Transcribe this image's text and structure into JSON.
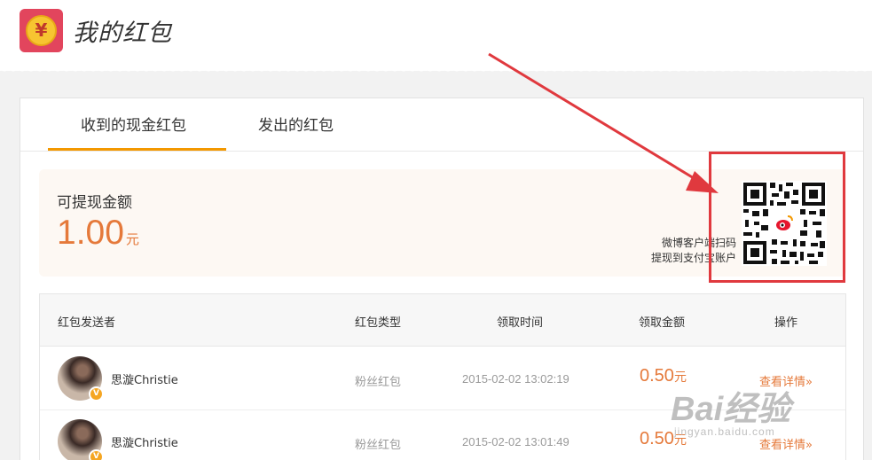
{
  "header": {
    "title": "我的红包",
    "logo_glyph": "¥"
  },
  "tabs": [
    {
      "label": "收到的现金红包",
      "active": true
    },
    {
      "label": "发出的红包",
      "active": false
    }
  ],
  "balance": {
    "label": "可提现金额",
    "amount": "1.00",
    "unit": "元",
    "qr_line1": "微博客户端扫码",
    "qr_line2": "提现到支付宝账户"
  },
  "table": {
    "columns": [
      "红包发送者",
      "红包类型",
      "领取时间",
      "领取金额",
      "操作"
    ],
    "rows": [
      {
        "sender": "思漩Christie",
        "type": "粉丝红包",
        "time": "2015-02-02 13:02:19",
        "amount": "0.50",
        "unit": "元",
        "action": "查看详情»",
        "badge": "V"
      },
      {
        "sender": "思漩Christie",
        "type": "粉丝红包",
        "time": "2015-02-02 13:01:49",
        "amount": "0.50",
        "unit": "元",
        "action": "查看详情»",
        "badge": "V"
      }
    ]
  },
  "watermark": {
    "big": "Bai经验",
    "small": "jingyan.baidu.com"
  },
  "colors": {
    "accent": "#f39800",
    "amount": "#e5793a",
    "annotation": "#e0393e",
    "logo_bg": "#e2455d"
  }
}
